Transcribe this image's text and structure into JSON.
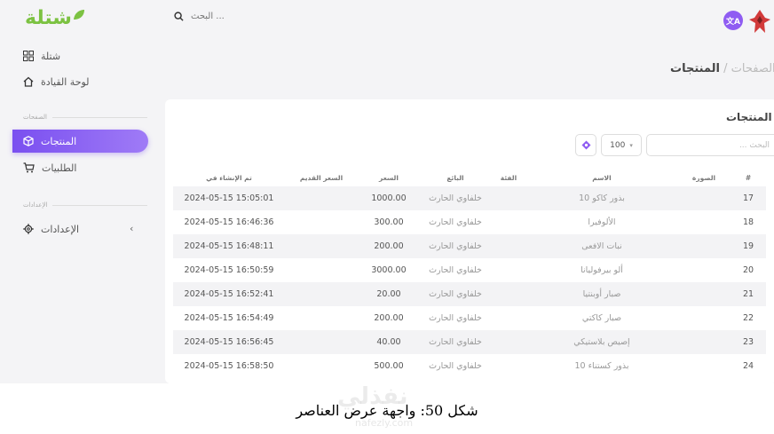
{
  "header": {
    "logo_text": "شتلة",
    "search_placeholder": "البحث ...",
    "lang_icon": "translate-icon",
    "lang_label": "文A"
  },
  "sidebar": {
    "top_items": [
      {
        "label": "شتلة",
        "icon": "grid-icon"
      },
      {
        "label": "لوحة القيادة",
        "icon": "home-icon"
      }
    ],
    "section_pages": "الصفحات",
    "items": [
      {
        "label": "المنتجات",
        "icon": "box-icon",
        "active": true
      },
      {
        "label": "الطلبيات",
        "icon": "cart-icon",
        "active": false
      }
    ],
    "section_settings": "الإعدادات",
    "settings_item": {
      "label": "الإعدادات",
      "icon": "gear-icon",
      "chevron": "‹"
    }
  },
  "breadcrumb": {
    "parent": "الصفحات",
    "sep": "/",
    "current": "المنتجات"
  },
  "card": {
    "title": "المنتجات",
    "search_placeholder": "البحث ...",
    "per_page": "100",
    "per_page_caret": "▾"
  },
  "table": {
    "columns": [
      "#",
      "الصورة",
      "الاسم",
      "الفئة",
      "البائع",
      "السعر",
      "السعر القديم",
      "تم الإنشاء في"
    ],
    "rows": [
      {
        "id": "17",
        "name": "10 بذور كاكو",
        "seller": "خلفاوي الحارث",
        "price": "1000.00",
        "created": "2024-05-15 15:05:01"
      },
      {
        "id": "18",
        "name": "الألوفيرا",
        "seller": "خلفاوي الحارث",
        "price": "300.00",
        "created": "2024-05-15 16:46:36"
      },
      {
        "id": "19",
        "name": "نبات الافعى",
        "seller": "خلفاوي الحارث",
        "price": "200.00",
        "created": "2024-05-15 16:48:11"
      },
      {
        "id": "20",
        "name": "ألو بيرفوليانا",
        "seller": "خلفاوي الحارث",
        "price": "3000.00",
        "created": "2024-05-15 16:50:59"
      },
      {
        "id": "21",
        "name": "صبار أوبنتيا",
        "seller": "خلفاوي الحارث",
        "price": "20.00",
        "created": "2024-05-15 16:52:41"
      },
      {
        "id": "22",
        "name": "صبار كاكتي",
        "seller": "خلفاوي الحارث",
        "price": "200.00",
        "created": "2024-05-15 16:54:49"
      },
      {
        "id": "23",
        "name": "إصيص بلاستيكي",
        "seller": "خلفاوي الحارث",
        "price": "40.00",
        "created": "2024-05-15 16:56:45"
      },
      {
        "id": "24",
        "name": "10 بذور كستناء",
        "seller": "خلفاوي الحارث",
        "price": "500.00",
        "created": "2024-05-15 16:58:50"
      }
    ]
  },
  "caption": "شكل 50: واجهة عرض العناصر",
  "watermark": "نفذلي",
  "watermark_url": "nafezly.com",
  "colors": {
    "accent": "#8f5cf2",
    "logo": "#7cc242"
  }
}
